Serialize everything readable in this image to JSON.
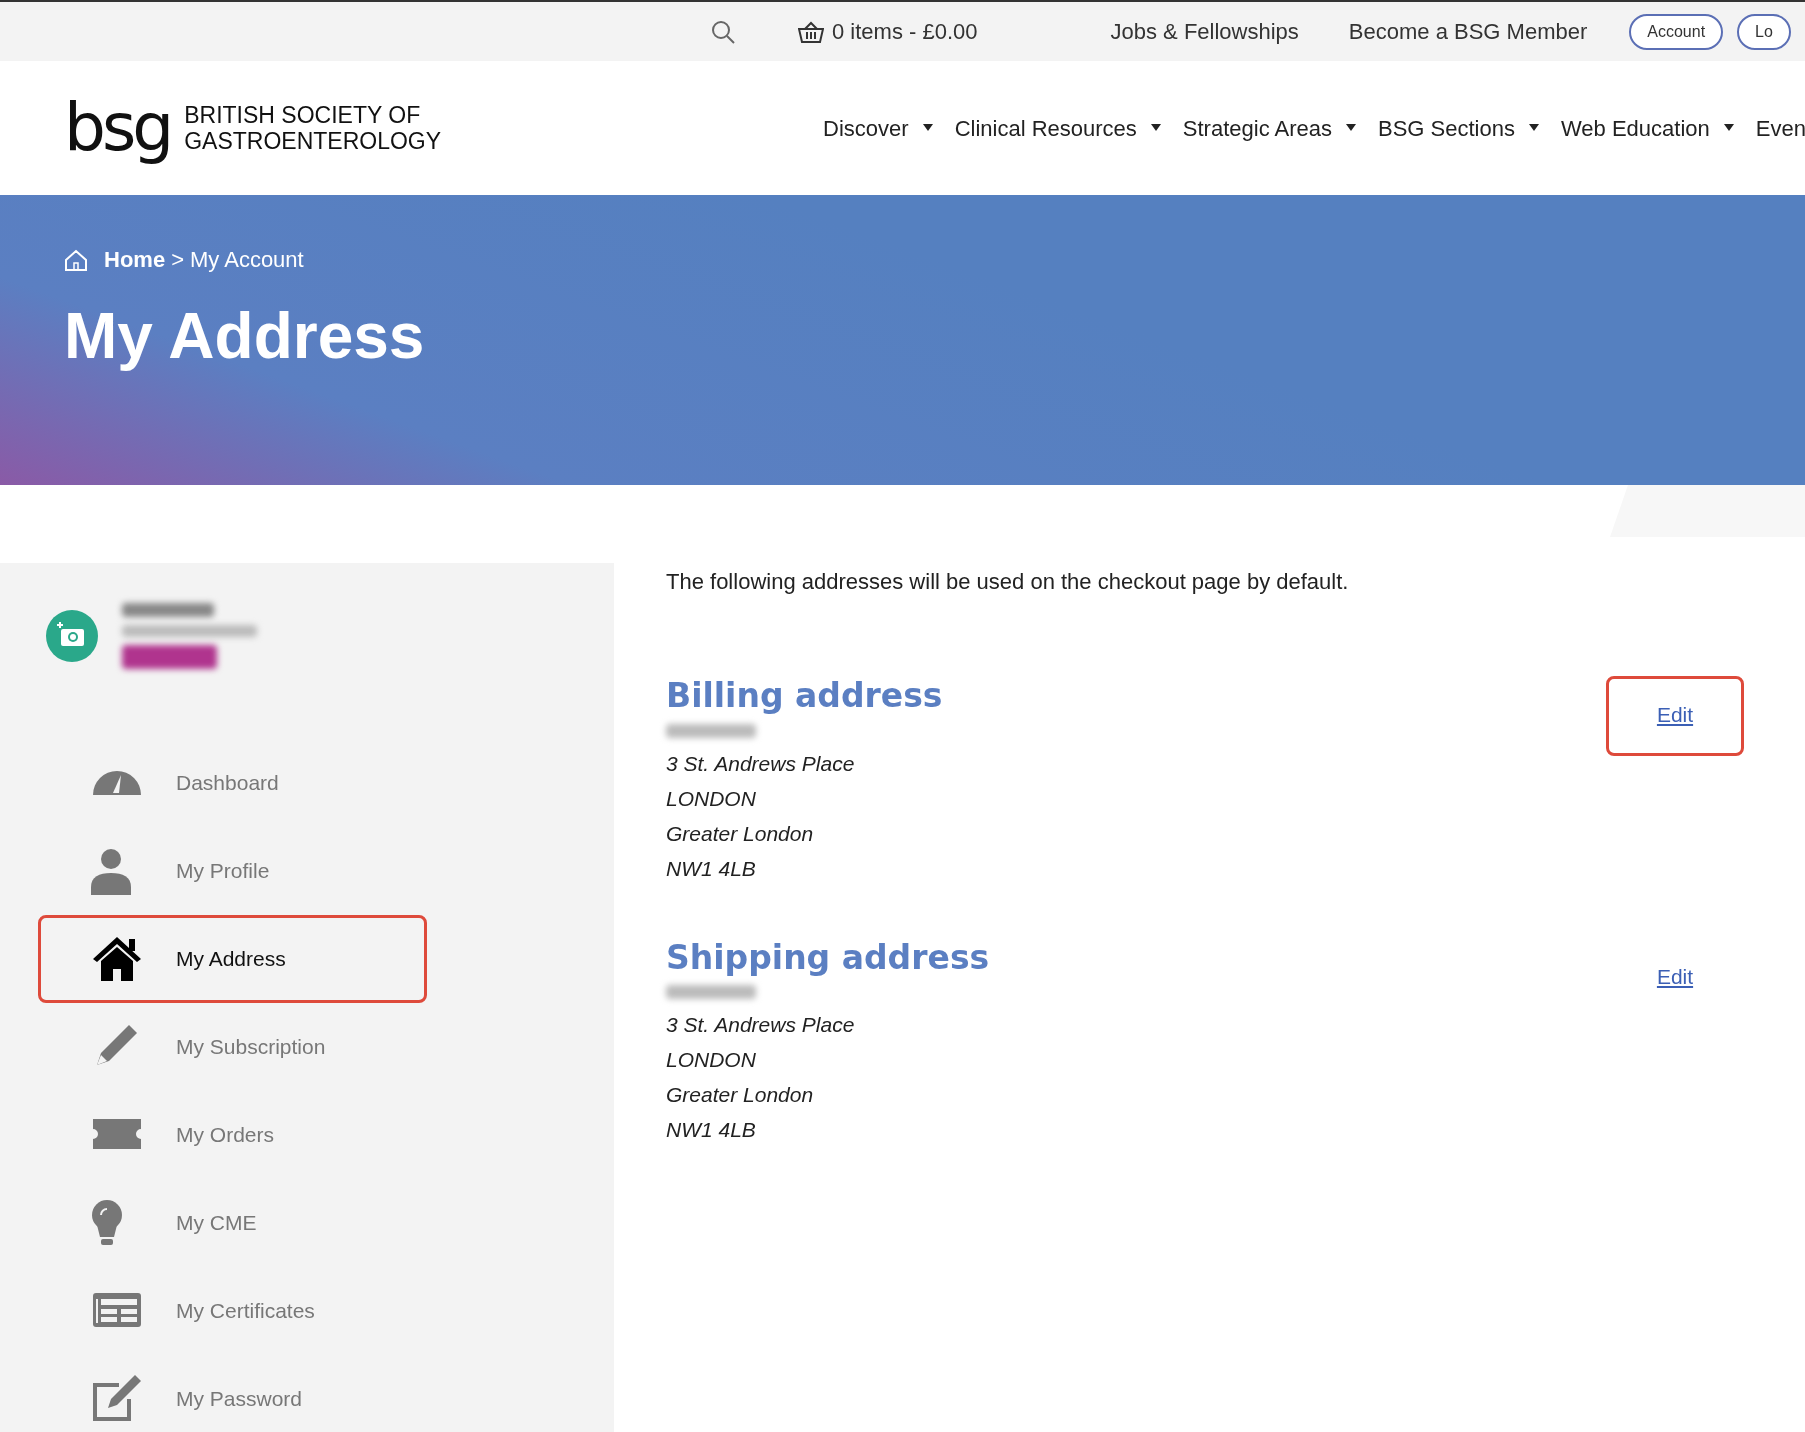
{
  "top_bar": {
    "cart": "0 items - £0.00",
    "links": [
      "Jobs & Fellowships",
      "Become a BSG Member"
    ],
    "buttons": [
      "Account",
      "Lo"
    ]
  },
  "header": {
    "logo_mark": "bsg",
    "logo_text": [
      "BRITISH SOCIETY OF",
      "GASTROENTEROLOGY"
    ],
    "nav": [
      {
        "label": "Discover",
        "dropdown": true
      },
      {
        "label": "Clinical Resources",
        "dropdown": true
      },
      {
        "label": "Strategic Areas",
        "dropdown": true
      },
      {
        "label": "BSG Sections",
        "dropdown": true
      },
      {
        "label": "Web Education",
        "dropdown": true
      },
      {
        "label": "Even",
        "dropdown": false
      }
    ]
  },
  "banner": {
    "breadcrumb": [
      "Home",
      "My Account"
    ],
    "separator": ">",
    "title": "My Address"
  },
  "sidebar": {
    "items": [
      {
        "label": "Dashboard",
        "selected": false,
        "highlighted": false
      },
      {
        "label": "My Profile",
        "selected": false,
        "highlighted": false
      },
      {
        "label": "My Address",
        "selected": true,
        "highlighted": true
      },
      {
        "label": "My Subscription",
        "selected": false,
        "highlighted": false
      },
      {
        "label": "My Orders",
        "selected": false,
        "highlighted": false
      },
      {
        "label": "My CME",
        "selected": false,
        "highlighted": false
      },
      {
        "label": "My Certificates",
        "selected": false,
        "highlighted": false
      },
      {
        "label": "My Password",
        "selected": false,
        "highlighted": false
      }
    ]
  },
  "content": {
    "intro": "The following addresses will be used on the checkout page by default.",
    "addresses": [
      {
        "title": "Billing address",
        "edit": "Edit",
        "highlighted": true,
        "lines": [
          "3 St. Andrews Place",
          "LONDON",
          "Greater London",
          "NW1 4LB"
        ]
      },
      {
        "title": "Shipping address",
        "edit": "Edit",
        "highlighted": false,
        "lines": [
          "3 St. Andrews Place",
          "LONDON",
          "Greater London",
          "NW1 4LB"
        ]
      }
    ]
  }
}
